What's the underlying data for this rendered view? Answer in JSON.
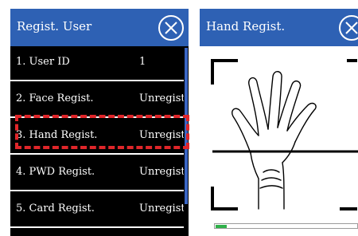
{
  "regist_user": {
    "title": "Regist. User",
    "items": [
      {
        "label": "1. User ID",
        "value": "1"
      },
      {
        "label": "2. Face Regist.",
        "value": "Unregist"
      },
      {
        "label": "3. Hand Regist.",
        "value": "Unregist"
      },
      {
        "label": "4. PWD Regist.",
        "value": "Unregist"
      },
      {
        "label": "5. Card Regist.",
        "value": "Unregist"
      }
    ],
    "highlighted_item": "3. Hand Regist."
  },
  "hand_regist": {
    "title": "Hand Regist.",
    "progress_fraction": 0.08
  },
  "colors": {
    "header": "#2e61b4",
    "menu_background": "#000000",
    "highlight": "#e0262a",
    "progress": "#2fb14a",
    "scrollbar": "#3a66c4"
  },
  "icons": [
    "close-circle-icon",
    "hand-outline-icon",
    "scan-frame-corners-icon"
  ]
}
